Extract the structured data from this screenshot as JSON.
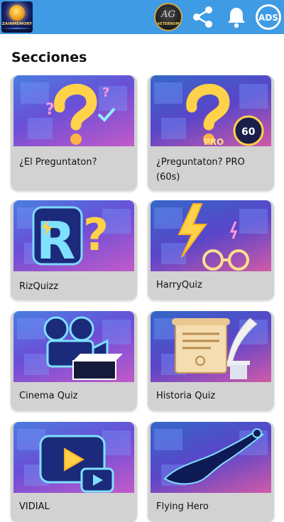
{
  "header": {
    "logo_text": "ZAINMEMORY",
    "avatar_initials": "AG",
    "avatar_name": "AETERNUM",
    "ads_label": "ADS"
  },
  "section_title": "Secciones",
  "cards": [
    {
      "label": "¿El Preguntaton?"
    },
    {
      "label": "¿Preguntaton? PRO (60s)"
    },
    {
      "label": "RizQuizz"
    },
    {
      "label": "HarryQuiz"
    },
    {
      "label": "Cinema Quiz"
    },
    {
      "label": "Historia Quiz"
    },
    {
      "label": "VIDIAL"
    },
    {
      "label": "Flying Hero"
    }
  ],
  "colors": {
    "appbar": "#3f9be3",
    "card": "#d2d2d2"
  }
}
